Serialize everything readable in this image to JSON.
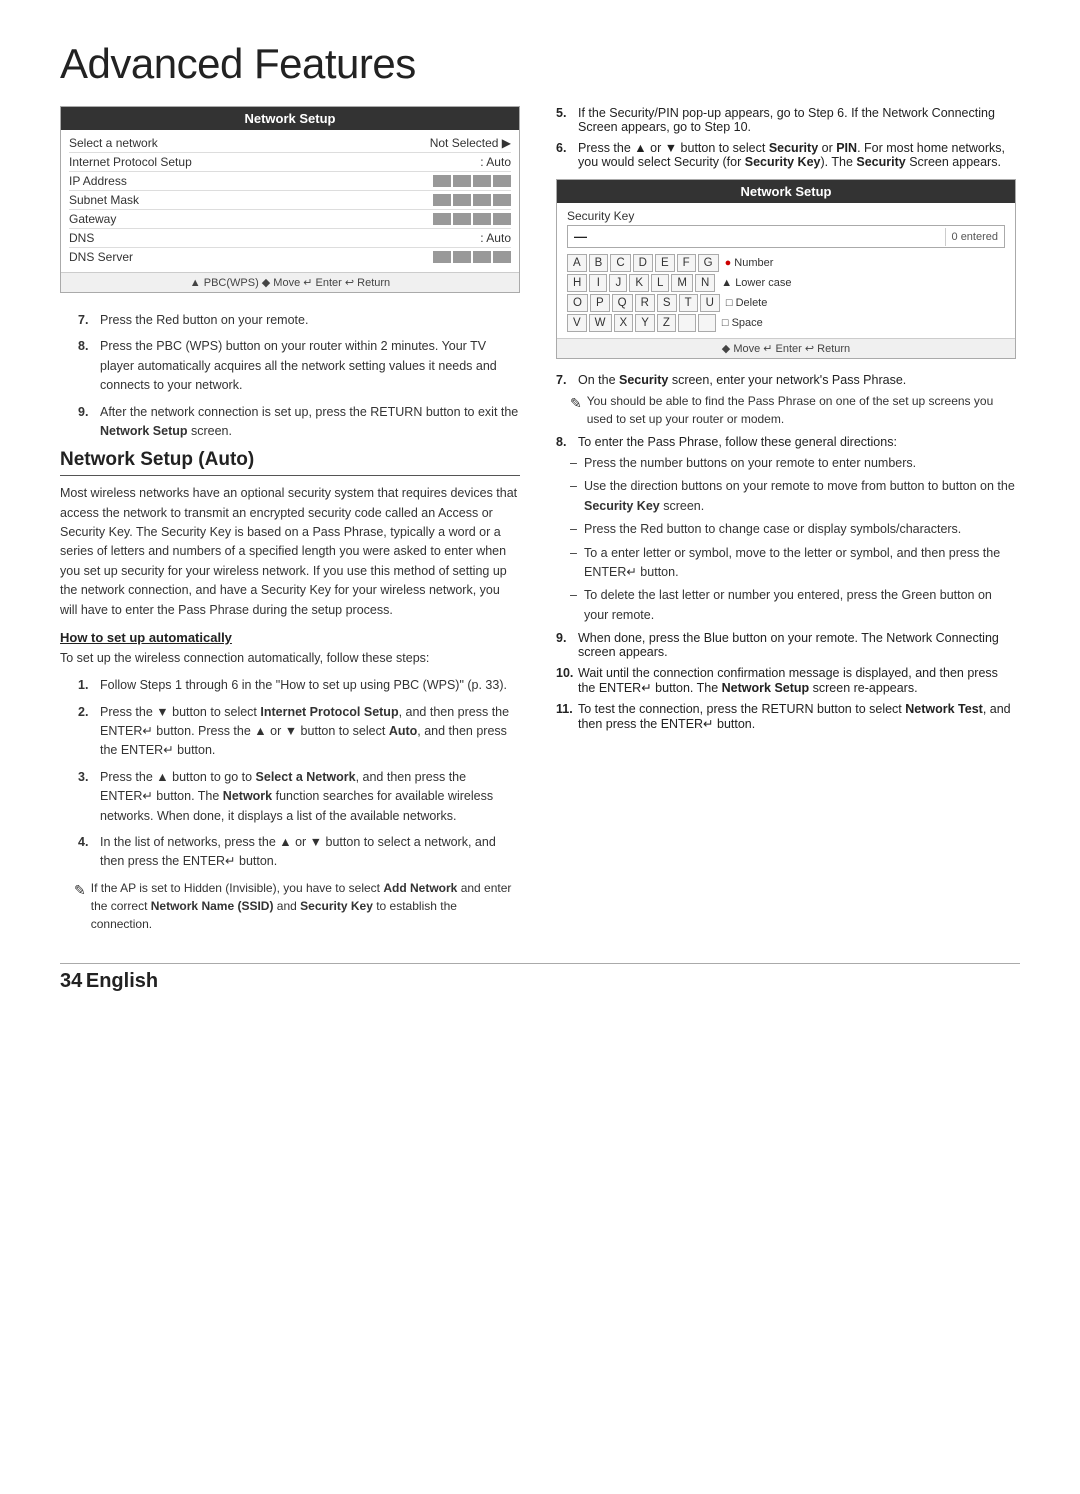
{
  "page": {
    "title": "Advanced Features",
    "page_number": "34",
    "page_number_label": "English"
  },
  "network_setup_box": {
    "header": "Network Setup",
    "rows": [
      {
        "label": "Select a network",
        "value": "Not Selected ▶",
        "has_blocks": false
      },
      {
        "label": "Internet Protocol Setup",
        "value": ": Auto",
        "has_blocks": false
      },
      {
        "label": "IP Address",
        "value": "",
        "has_blocks": true
      },
      {
        "label": "Subnet Mask",
        "value": "",
        "has_blocks": true
      },
      {
        "label": "Gateway",
        "value": "",
        "has_blocks": true
      },
      {
        "label": "DNS",
        "value": ": Auto",
        "has_blocks": false
      },
      {
        "label": "DNS Server",
        "value": "",
        "has_blocks": true
      }
    ],
    "footer": "▲ PBC(WPS) ◆ Move  ↵ Enter  ↩ Return"
  },
  "section_heading": "Network Setup (Auto)",
  "intro_paragraph": "Most wireless networks have an optional security system that requires devices that access the network to transmit an encrypted security code called an Access or Security Key. The Security Key is based on a Pass Phrase, typically a word or a series of letters and numbers of a specified length you were asked to enter when you set up security for your wireless network. If you use this method of setting up the network connection, and have a Security Key for your wireless network, you will have to enter the Pass Phrase during the setup process.",
  "subsection_heading": "How to set up automatically",
  "subsection_intro": "To set up the wireless connection automatically, follow these steps:",
  "steps_left": [
    {
      "num": "1.",
      "text": "Follow Steps 1 through 6 in the \"How to set up using PBC (WPS)\" (p. 33)."
    },
    {
      "num": "2.",
      "text": "Press the ▼ button to select Internet Protocol Setup, and then press the ENTER↵ button. Press the ▲ or ▼ button to select Auto, and then press the ENTER↵ button.",
      "bold_words": [
        "Internet Protocol Setup",
        "Auto"
      ]
    },
    {
      "num": "3.",
      "text": "Press the ▲ button to go to Select a Network, and then press the ENTER↵ button. The Network function searches for available wireless networks. When done, it displays a list of the available networks.",
      "bold_words": [
        "Select a Network",
        "Network"
      ]
    },
    {
      "num": "4.",
      "text": "In the list of networks, press the ▲ or ▼ button to select a network, and then press the ENTER↵ button."
    }
  ],
  "note_step4": "If the AP is set to Hidden (Invisible), you have to select Add Network and enter the correct Network Name (SSID) and Security Key to establish the connection.",
  "security_box": {
    "header": "Network Setup",
    "security_key_label": "Security Key",
    "cursor": "—",
    "entered": "0 entered",
    "keyboard_rows": [
      {
        "keys": [
          "A",
          "B",
          "C",
          "D",
          "E",
          "F",
          "G"
        ],
        "label": "Number",
        "label_icon": "🔴"
      },
      {
        "keys": [
          "H",
          "I",
          "J",
          "K",
          "L",
          "M",
          "N"
        ],
        "label": "Lower case",
        "label_icon": "▲"
      },
      {
        "keys": [
          "O",
          "P",
          "Q",
          "R",
          "S",
          "T",
          "U"
        ],
        "label": "Delete",
        "label_icon": "□"
      },
      {
        "keys": [
          "V",
          "W",
          "X",
          "Y",
          "Z",
          "",
          ""
        ],
        "label": "Space",
        "label_icon": "□"
      }
    ],
    "footer": "◆ Move  ↵ Enter  ↩ Return"
  },
  "right_steps": [
    {
      "num": "5.",
      "text": "If the Security/PIN pop-up appears, go to Step 6. If the Network Connecting Screen appears, go to Step 10."
    },
    {
      "num": "6.",
      "text": "Press the ▲ or ▼ button to select Security or PIN. For most home networks, you would select Security (for Security Key). The Security Screen appears.",
      "bold_words": [
        "Security",
        "PIN",
        "Security Key",
        "Security"
      ]
    },
    {
      "num": "7.",
      "text": "On the Security screen, enter your network's Pass Phrase.",
      "bold_words": [
        "Security"
      ]
    },
    {
      "note": "You should be able to find the Pass Phrase on one of the set up screens you used to set up your router or modem."
    },
    {
      "num": "8.",
      "text": "To enter the Pass Phrase, follow these general directions:"
    }
  ],
  "dash_items": [
    "Press the number buttons on your remote to enter numbers.",
    "Use the direction buttons on your remote to move from button to button on the Security Key screen.",
    "Press the Red button to change case or display symbols/characters.",
    "To a enter letter or symbol, move to the letter or symbol, and then press the ENTER↵ button.",
    "To delete the last letter or number you entered, press the Green button on your remote."
  ],
  "steps_right_continued": [
    {
      "num": "9.",
      "text": "When done, press the Blue button on your remote. The Network Connecting screen appears."
    },
    {
      "num": "10.",
      "text": "Wait until the connection confirmation message is displayed, and then press the ENTER↵ button. The Network Setup screen re-appears.",
      "bold_words": [
        "Network Setup"
      ]
    },
    {
      "num": "11.",
      "text": "To test the connection, press the RETURN button to select Network Test, and then press the ENTER↵ button.",
      "bold_words": [
        "Network Test"
      ]
    }
  ]
}
